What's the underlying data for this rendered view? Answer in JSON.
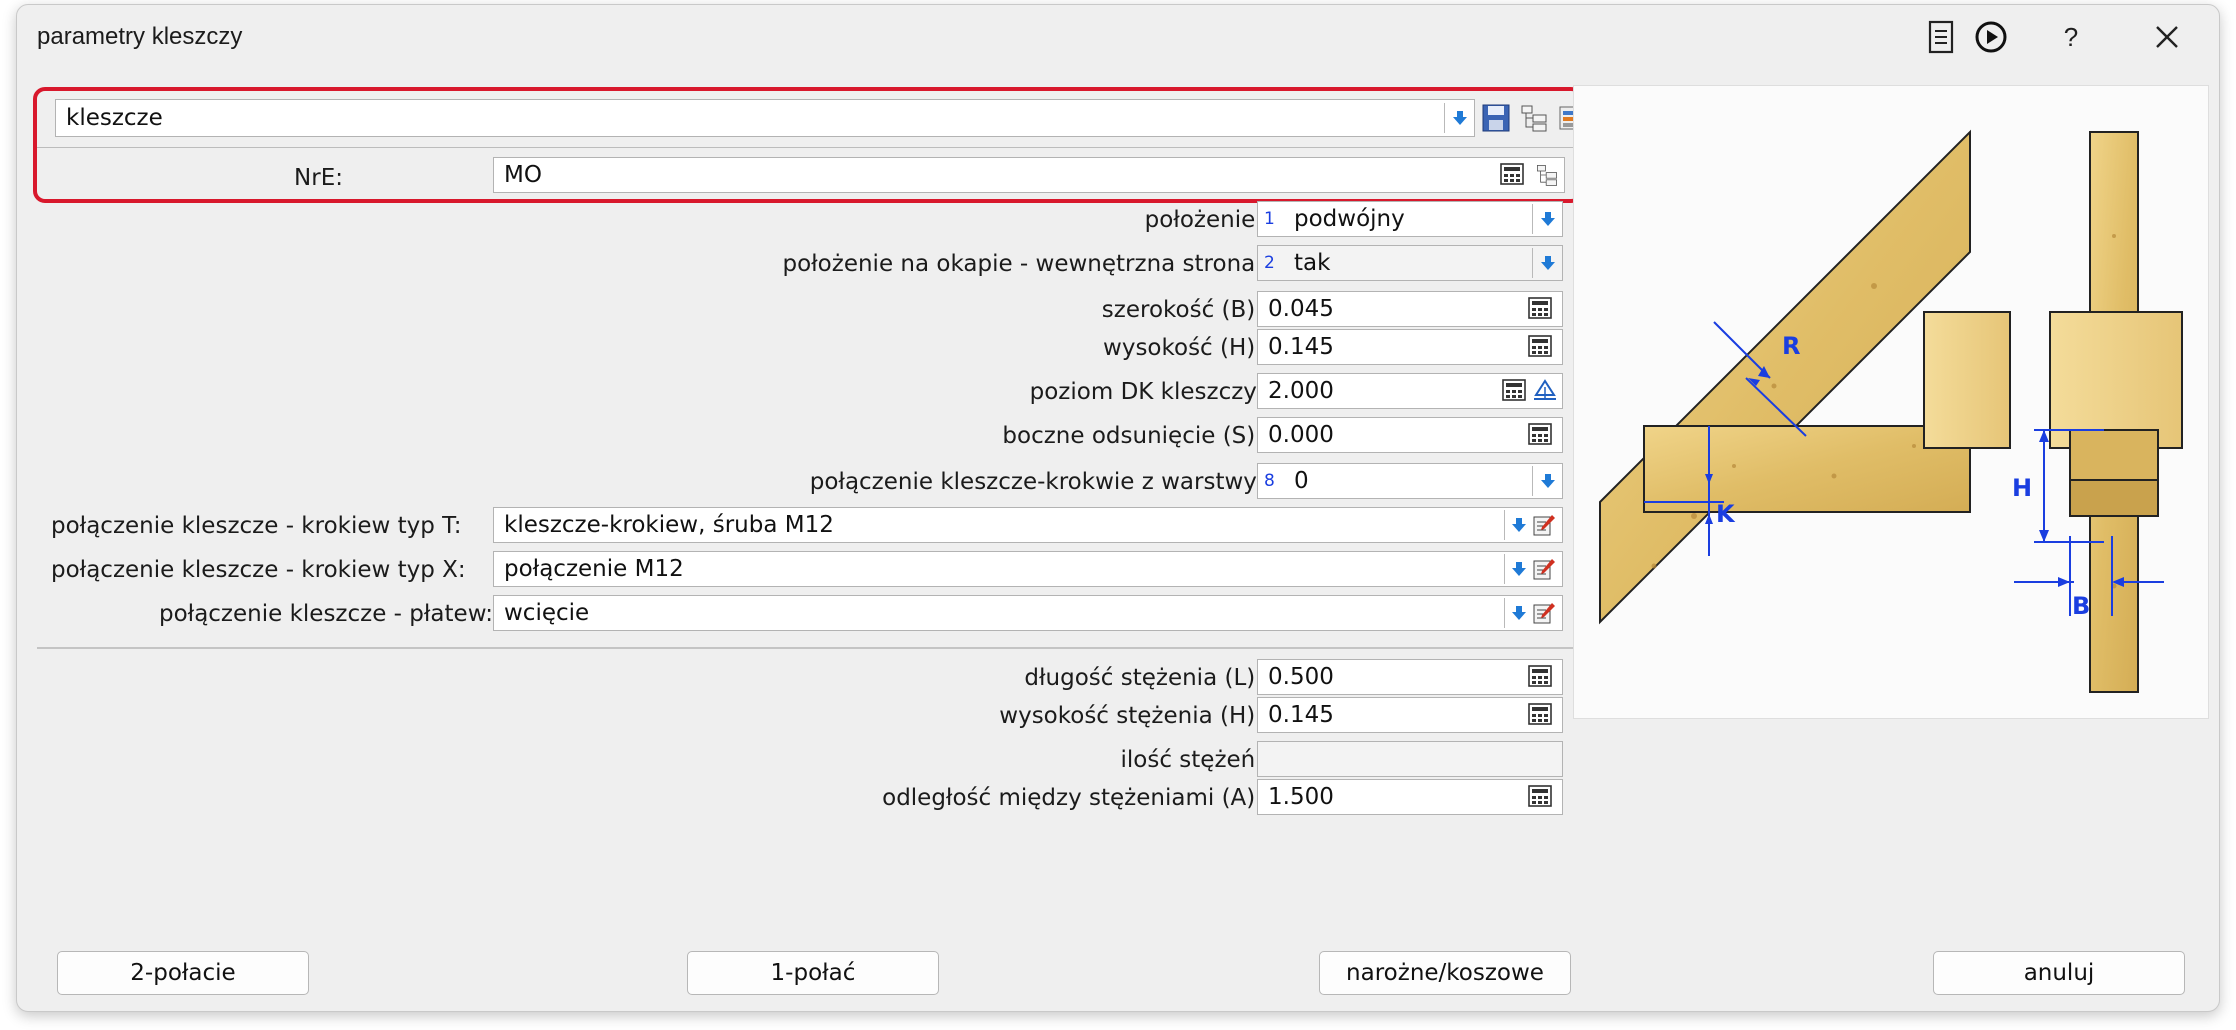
{
  "window": {
    "title": "parametry kleszczy"
  },
  "titlebar": {
    "icons": [
      "notes-icon",
      "play-circle-icon",
      "help-icon",
      "close-icon"
    ],
    "help_label": "?"
  },
  "profile": {
    "value": "kleszcze"
  },
  "nre": {
    "label": "NrE:",
    "value": "MO"
  },
  "fields": {
    "polozenie": {
      "label": "położenie:",
      "index": "1",
      "value": "podwójny"
    },
    "okap": {
      "label": "położenie na okapie - wewnętrzna strona:",
      "index": "2",
      "value": "tak"
    },
    "szerokosc": {
      "label": "szerokość (B):",
      "value": "0.045"
    },
    "wysokosc": {
      "label": "wysokość (H):",
      "value": "0.145"
    },
    "poziom": {
      "label": "poziom DK kleszczy:",
      "value": "2.000"
    },
    "odsuniecie": {
      "label": "boczne odsunięcie (S):",
      "value": "0.000"
    },
    "warstwa": {
      "label": "połączenie kleszcze-krokwie z warstwy:",
      "index": "8",
      "value": "0"
    },
    "typT": {
      "label": "połączenie kleszcze - krokiew typ T:",
      "value": "kleszcze-krokiew, śruba M12"
    },
    "typX": {
      "label": "połączenie kleszcze - krokiew typ X:",
      "value": "połączenie M12"
    },
    "platew": {
      "label": "połączenie kleszcze - płatew:",
      "value": "wcięcie"
    },
    "dlugosc": {
      "label": "długość stężenia (L):",
      "value": "0.500"
    },
    "wys_stez": {
      "label": "wysokość stężenia (H):",
      "value": "0.145"
    },
    "ilosc": {
      "label": "ilość stężeń:",
      "value": ""
    },
    "odleglosc": {
      "label": "odległość między stężeniami (A):",
      "value": "1.500"
    }
  },
  "buttons": {
    "dwa_polacie": "2-połacie",
    "jedno_polac": "1-połać",
    "narozne": "narożne/koszowe",
    "anuluj": "anuluj"
  },
  "diagram": {
    "labels": {
      "R": "R",
      "K": "K",
      "H": "H",
      "B": "B"
    }
  },
  "colors": {
    "highlight": "#d8182c",
    "accent_blue": "#1a3ee0",
    "wood": "#e3c06b"
  }
}
